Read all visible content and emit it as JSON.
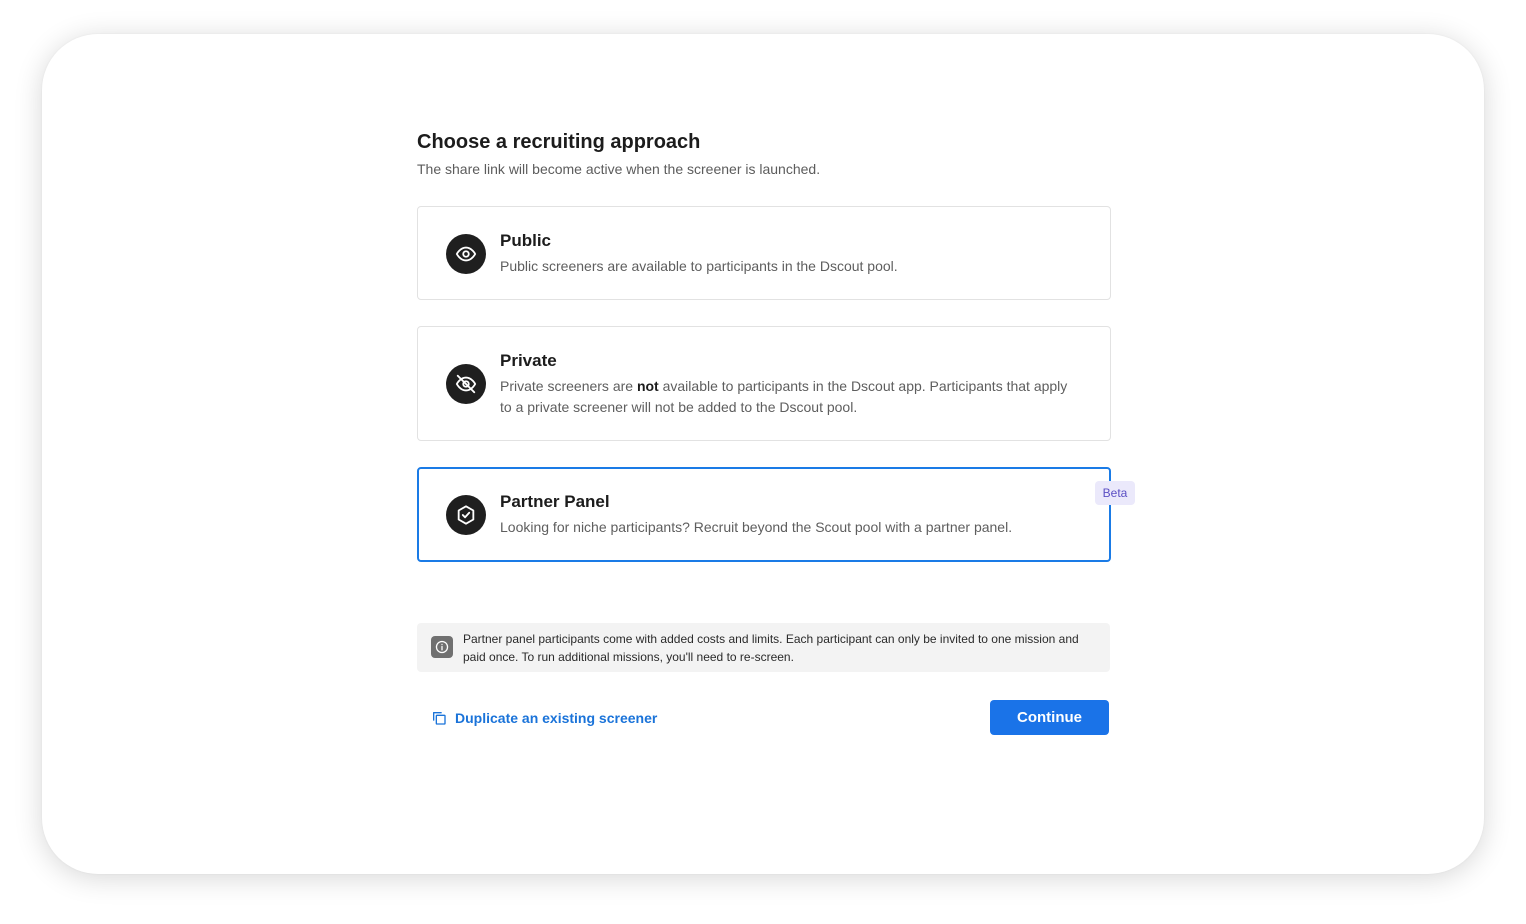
{
  "header": {
    "title": "Choose a recruiting approach",
    "subtitle": "The share link will become active when the screener is launched."
  },
  "options": [
    {
      "title": "Public",
      "description": "Public screeners are available to participants in the Dscout pool.",
      "icon": "eye-icon",
      "selected": false
    },
    {
      "title": "Private",
      "description_before": "Private screeners are ",
      "description_bold": "not",
      "description_after": " available to participants in the Dscout app. Participants that apply to a private screener will not be added to the Dscout pool.",
      "icon": "eye-off-icon",
      "selected": false
    },
    {
      "title": "Partner Panel",
      "description": "Looking for niche participants? Recruit beyond the Scout pool with a partner panel.",
      "icon": "shield-check-icon",
      "badge": "Beta",
      "selected": true
    }
  ],
  "notice": {
    "icon": "info-icon",
    "text": "Partner panel participants come with added costs and limits. Each participant can only be invited to one mission and paid once. To run additional missions, you'll need to re-screen."
  },
  "footer": {
    "duplicate_icon": "copy-icon",
    "duplicate_label": "Duplicate an existing screener",
    "continue_label": "Continue"
  },
  "colors": {
    "accent": "#1a73e8",
    "selected_border": "#1a7be6",
    "badge_bg": "#ebe9fb",
    "badge_text": "#5b4fc4",
    "icon_bg": "#1f1f1f"
  }
}
